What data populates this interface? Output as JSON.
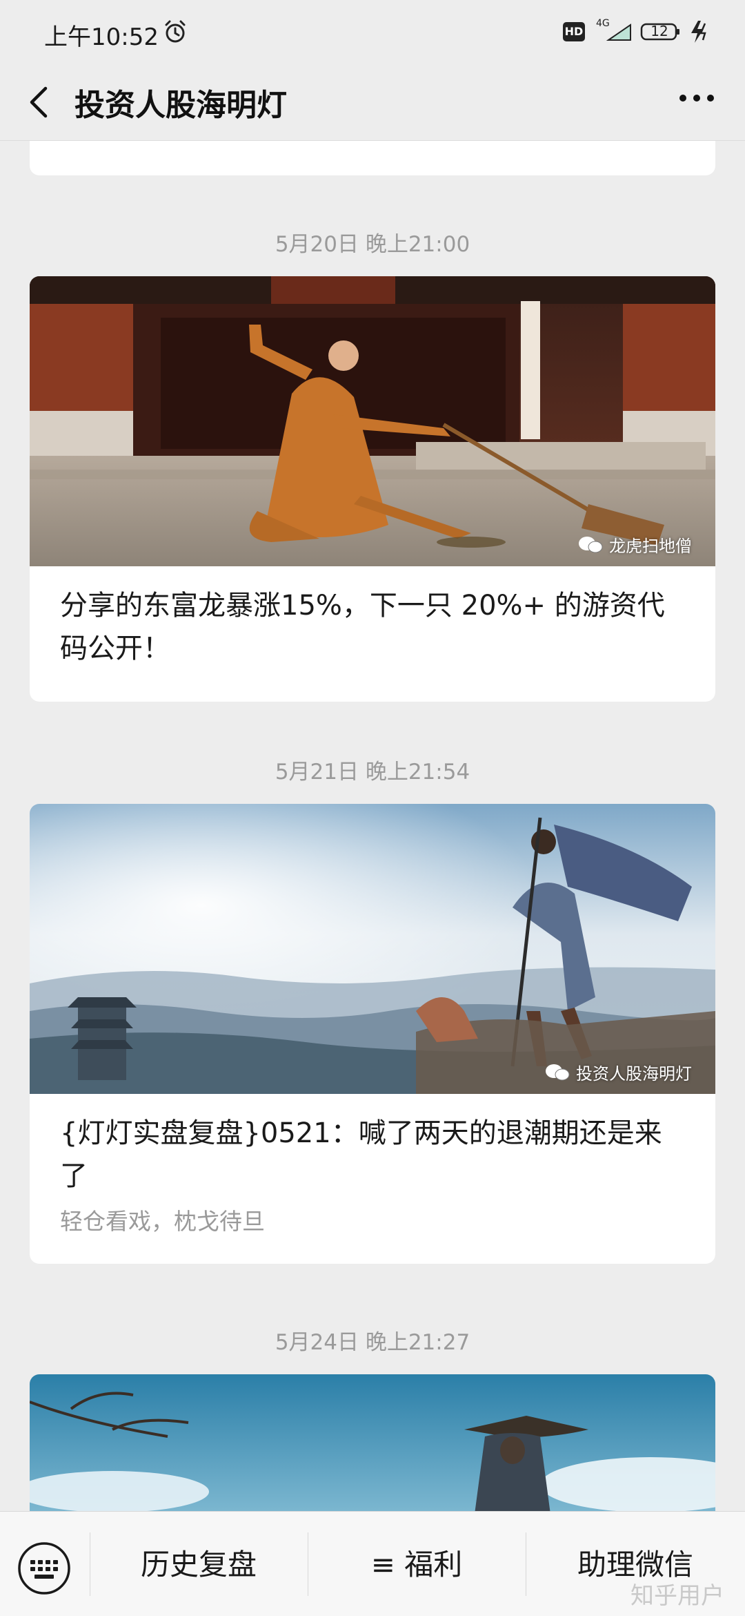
{
  "status_bar": {
    "time": "上午10:52",
    "hd": "HD",
    "network": "4G",
    "battery": "12"
  },
  "nav": {
    "title": "投资人股海明灯"
  },
  "feed": [
    {
      "date": "5月20日 晚上21:00",
      "watermark": "龙虎扫地僧",
      "title": "分享的东富龙暴涨15%，下一只 20%+ 的游资代码公开！",
      "subtitle": ""
    },
    {
      "date": "5月21日 晚上21:54",
      "watermark": "投资人股海明灯",
      "title": "{灯灯实盘复盘}0521：喊了两天的退潮期还是来了",
      "subtitle": "轻仓看戏，枕戈待旦"
    },
    {
      "date": "5月24日 晚上21:27"
    }
  ],
  "bottom_menu": {
    "items": [
      "历史复盘",
      "≡ 福利",
      "助理微信"
    ]
  },
  "overlay_watermark": "知乎用户",
  "colors": {
    "background": "#ededed",
    "card": "#ffffff",
    "muted_text": "#9a9a9a"
  }
}
